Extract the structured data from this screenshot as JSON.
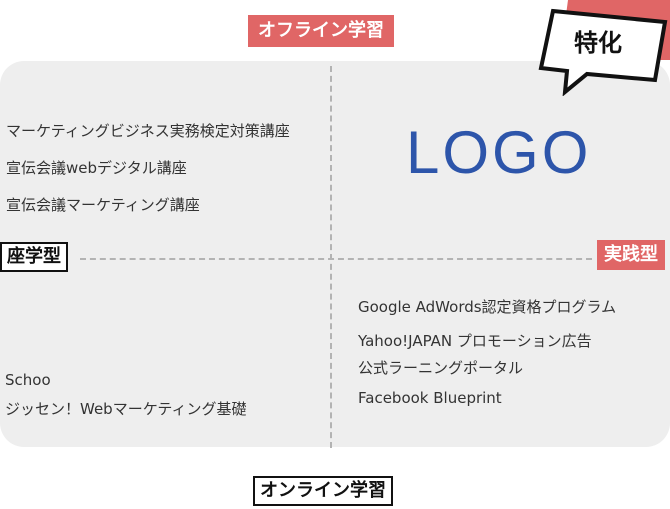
{
  "axes": {
    "top": "オフライン学習",
    "bottom": "オンライン学習",
    "left": "座学型",
    "right": "実践型"
  },
  "badge": {
    "label": "特化"
  },
  "logo": {
    "text": "LOGO"
  },
  "quadrants": {
    "top_left": [
      "マーケティングビジネス実務検定対策講座",
      "宣伝会議webデジタル講座",
      "宣伝会議マーケティング講座"
    ],
    "bottom_right": [
      "Google AdWords認定資格プログラム",
      "Yahoo!JAPAN プロモーション広告",
      "公式ラーニングポータル",
      "Facebook Blueprint"
    ],
    "bottom_left": [
      "Schoo",
      "ジッセン！Webマーケティング基礎"
    ]
  },
  "colors": {
    "accent_red": "#e06666",
    "logo_blue": "#2d55aa",
    "panel_gray": "#eeeeee"
  }
}
